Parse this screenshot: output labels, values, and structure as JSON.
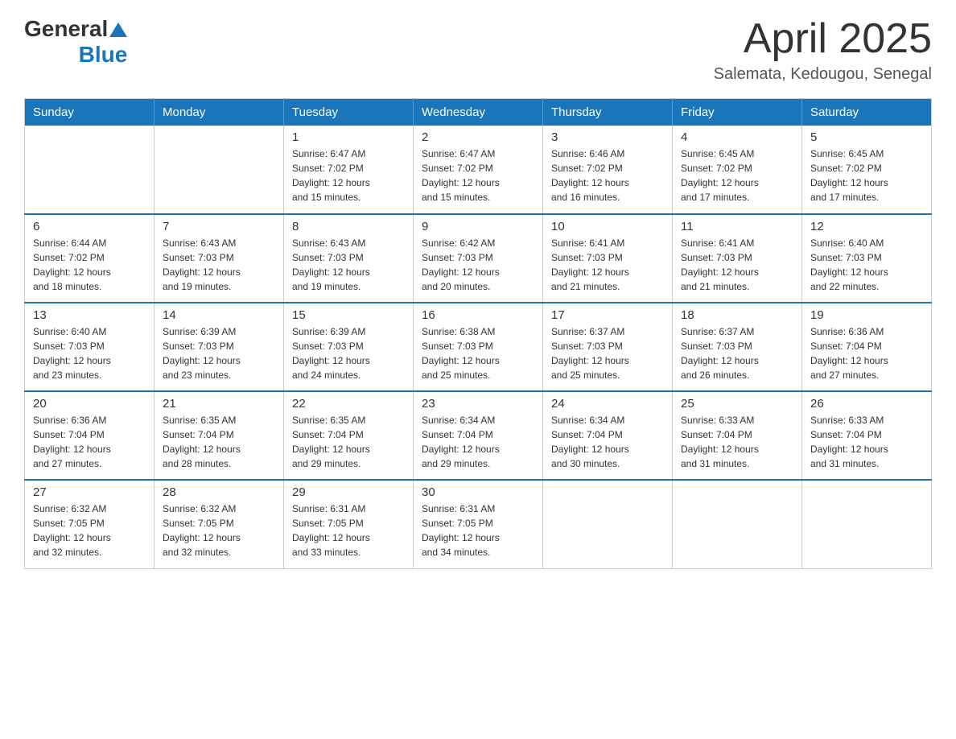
{
  "header": {
    "logo_general": "General",
    "logo_blue": "Blue",
    "title": "April 2025",
    "location": "Salemata, Kedougou, Senegal"
  },
  "calendar": {
    "days_of_week": [
      "Sunday",
      "Monday",
      "Tuesday",
      "Wednesday",
      "Thursday",
      "Friday",
      "Saturday"
    ],
    "weeks": [
      [
        {
          "day": "",
          "info": ""
        },
        {
          "day": "",
          "info": ""
        },
        {
          "day": "1",
          "info": "Sunrise: 6:47 AM\nSunset: 7:02 PM\nDaylight: 12 hours\nand 15 minutes."
        },
        {
          "day": "2",
          "info": "Sunrise: 6:47 AM\nSunset: 7:02 PM\nDaylight: 12 hours\nand 15 minutes."
        },
        {
          "day": "3",
          "info": "Sunrise: 6:46 AM\nSunset: 7:02 PM\nDaylight: 12 hours\nand 16 minutes."
        },
        {
          "day": "4",
          "info": "Sunrise: 6:45 AM\nSunset: 7:02 PM\nDaylight: 12 hours\nand 17 minutes."
        },
        {
          "day": "5",
          "info": "Sunrise: 6:45 AM\nSunset: 7:02 PM\nDaylight: 12 hours\nand 17 minutes."
        }
      ],
      [
        {
          "day": "6",
          "info": "Sunrise: 6:44 AM\nSunset: 7:02 PM\nDaylight: 12 hours\nand 18 minutes."
        },
        {
          "day": "7",
          "info": "Sunrise: 6:43 AM\nSunset: 7:03 PM\nDaylight: 12 hours\nand 19 minutes."
        },
        {
          "day": "8",
          "info": "Sunrise: 6:43 AM\nSunset: 7:03 PM\nDaylight: 12 hours\nand 19 minutes."
        },
        {
          "day": "9",
          "info": "Sunrise: 6:42 AM\nSunset: 7:03 PM\nDaylight: 12 hours\nand 20 minutes."
        },
        {
          "day": "10",
          "info": "Sunrise: 6:41 AM\nSunset: 7:03 PM\nDaylight: 12 hours\nand 21 minutes."
        },
        {
          "day": "11",
          "info": "Sunrise: 6:41 AM\nSunset: 7:03 PM\nDaylight: 12 hours\nand 21 minutes."
        },
        {
          "day": "12",
          "info": "Sunrise: 6:40 AM\nSunset: 7:03 PM\nDaylight: 12 hours\nand 22 minutes."
        }
      ],
      [
        {
          "day": "13",
          "info": "Sunrise: 6:40 AM\nSunset: 7:03 PM\nDaylight: 12 hours\nand 23 minutes."
        },
        {
          "day": "14",
          "info": "Sunrise: 6:39 AM\nSunset: 7:03 PM\nDaylight: 12 hours\nand 23 minutes."
        },
        {
          "day": "15",
          "info": "Sunrise: 6:39 AM\nSunset: 7:03 PM\nDaylight: 12 hours\nand 24 minutes."
        },
        {
          "day": "16",
          "info": "Sunrise: 6:38 AM\nSunset: 7:03 PM\nDaylight: 12 hours\nand 25 minutes."
        },
        {
          "day": "17",
          "info": "Sunrise: 6:37 AM\nSunset: 7:03 PM\nDaylight: 12 hours\nand 25 minutes."
        },
        {
          "day": "18",
          "info": "Sunrise: 6:37 AM\nSunset: 7:03 PM\nDaylight: 12 hours\nand 26 minutes."
        },
        {
          "day": "19",
          "info": "Sunrise: 6:36 AM\nSunset: 7:04 PM\nDaylight: 12 hours\nand 27 minutes."
        }
      ],
      [
        {
          "day": "20",
          "info": "Sunrise: 6:36 AM\nSunset: 7:04 PM\nDaylight: 12 hours\nand 27 minutes."
        },
        {
          "day": "21",
          "info": "Sunrise: 6:35 AM\nSunset: 7:04 PM\nDaylight: 12 hours\nand 28 minutes."
        },
        {
          "day": "22",
          "info": "Sunrise: 6:35 AM\nSunset: 7:04 PM\nDaylight: 12 hours\nand 29 minutes."
        },
        {
          "day": "23",
          "info": "Sunrise: 6:34 AM\nSunset: 7:04 PM\nDaylight: 12 hours\nand 29 minutes."
        },
        {
          "day": "24",
          "info": "Sunrise: 6:34 AM\nSunset: 7:04 PM\nDaylight: 12 hours\nand 30 minutes."
        },
        {
          "day": "25",
          "info": "Sunrise: 6:33 AM\nSunset: 7:04 PM\nDaylight: 12 hours\nand 31 minutes."
        },
        {
          "day": "26",
          "info": "Sunrise: 6:33 AM\nSunset: 7:04 PM\nDaylight: 12 hours\nand 31 minutes."
        }
      ],
      [
        {
          "day": "27",
          "info": "Sunrise: 6:32 AM\nSunset: 7:05 PM\nDaylight: 12 hours\nand 32 minutes."
        },
        {
          "day": "28",
          "info": "Sunrise: 6:32 AM\nSunset: 7:05 PM\nDaylight: 12 hours\nand 32 minutes."
        },
        {
          "day": "29",
          "info": "Sunrise: 6:31 AM\nSunset: 7:05 PM\nDaylight: 12 hours\nand 33 minutes."
        },
        {
          "day": "30",
          "info": "Sunrise: 6:31 AM\nSunset: 7:05 PM\nDaylight: 12 hours\nand 34 minutes."
        },
        {
          "day": "",
          "info": ""
        },
        {
          "day": "",
          "info": ""
        },
        {
          "day": "",
          "info": ""
        }
      ]
    ]
  }
}
